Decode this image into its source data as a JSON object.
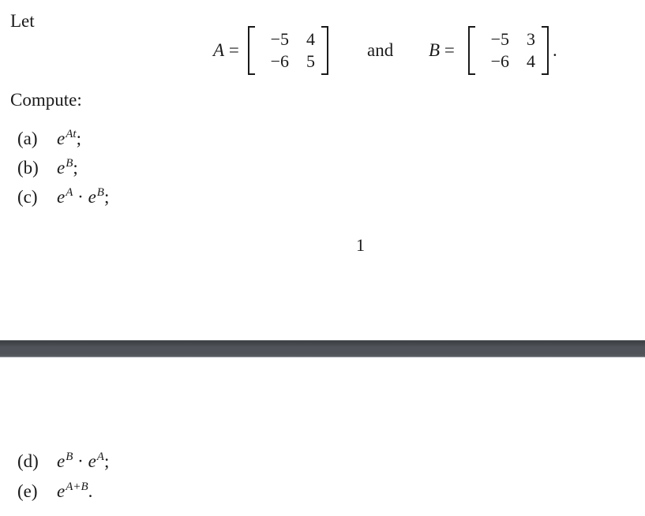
{
  "page1": {
    "intro": "Let",
    "matrix_a": {
      "name": "A",
      "eq": "=",
      "rows": [
        [
          "−5",
          "4"
        ],
        [
          "−6",
          "5"
        ]
      ]
    },
    "conjunction": "and",
    "matrix_b": {
      "name": "B",
      "eq": "=",
      "rows": [
        [
          "−5",
          "3"
        ],
        [
          "−6",
          "4"
        ]
      ],
      "trailing": "."
    },
    "compute_label": "Compute:",
    "items": [
      {
        "label": "(a)",
        "base": "e",
        "exp": "At",
        "rest": ";"
      },
      {
        "label": "(b)",
        "base": "e",
        "exp": "B",
        "rest": ";"
      },
      {
        "label": "(c)",
        "base": "e",
        "exp": "A",
        "mid": " · ",
        "base2": "e",
        "exp2": "B",
        "rest": ";"
      }
    ],
    "page_number": "1"
  },
  "page2": {
    "items": [
      {
        "label": "(d)",
        "base": "e",
        "exp": "B",
        "mid": " · ",
        "base2": "e",
        "exp2": "A",
        "rest": ";"
      },
      {
        "label": "(e)",
        "base": "e",
        "exp": "A+B",
        "rest": "."
      }
    ]
  }
}
